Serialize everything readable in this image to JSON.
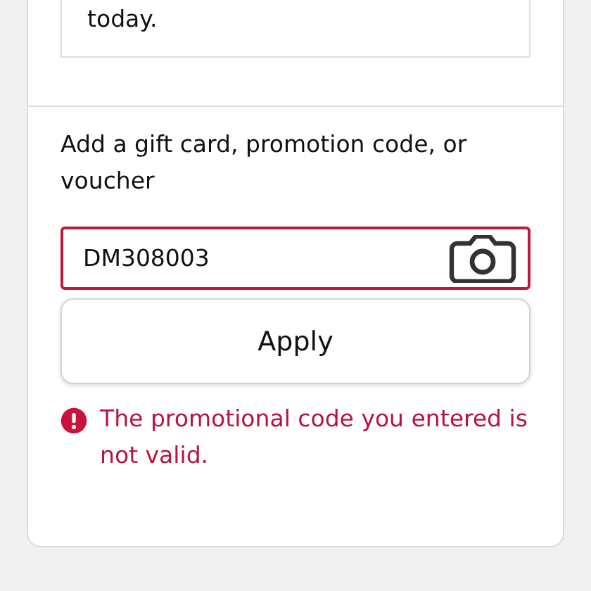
{
  "notice": {
    "text": "today."
  },
  "promo": {
    "label": "Add a gift card, promotion code, or voucher",
    "field": {
      "value": "DM308003",
      "invalid": true
    },
    "apply_button": "Apply",
    "error": "The promotional code you entered is not valid."
  }
}
